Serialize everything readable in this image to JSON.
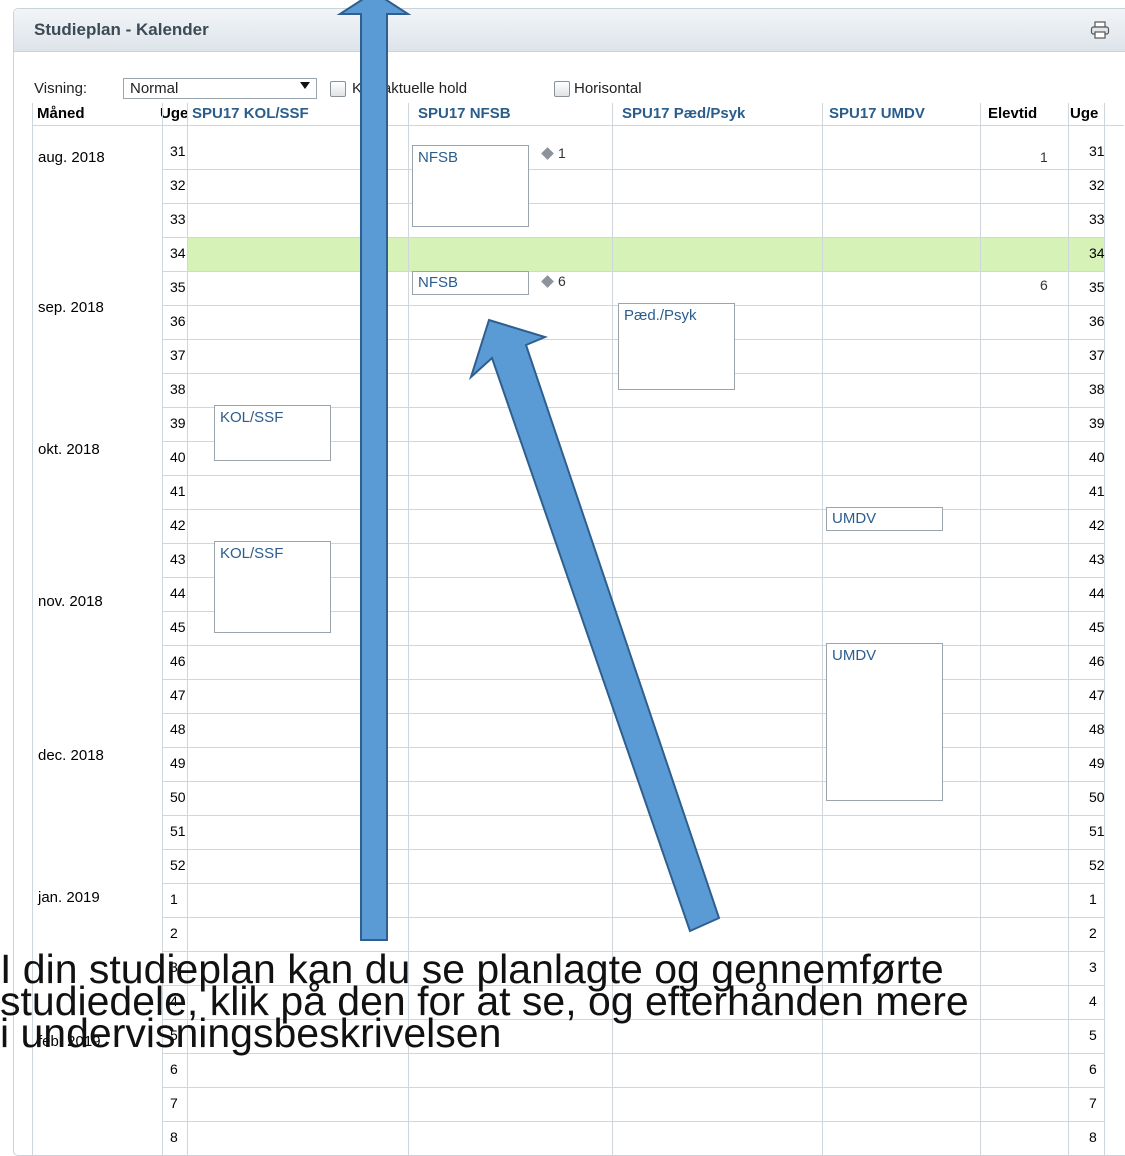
{
  "panel": {
    "title": "Studieplan - Kalender",
    "print_icon": "printer-icon"
  },
  "toolbar": {
    "visning_label": "Visning:",
    "visning_value": "Normal",
    "kun_aktuelle_label": "Kun aktuelle hold",
    "horisontal_label": "Horisontal"
  },
  "table": {
    "headers": {
      "month": "Måned",
      "week": "Uge",
      "col1": "SPU17 KOL/SSF",
      "col2": "SPU17 NFSB",
      "col3": "SPU17 Pæd/Psyk",
      "col4": "SPU17 UMDV",
      "elevtid": "Elevtid",
      "week_right": "Uge"
    },
    "months": [
      "aug. 2018",
      "sep. 2018",
      "okt. 2018",
      "nov. 2018",
      "dec. 2018",
      "jan. 2019",
      "feb. 2019"
    ],
    "weeks": [
      "31",
      "32",
      "33",
      "34",
      "35",
      "36",
      "37",
      "38",
      "39",
      "40",
      "41",
      "42",
      "43",
      "44",
      "45",
      "46",
      "47",
      "48",
      "49",
      "50",
      "51",
      "52",
      "1",
      "2",
      "3",
      "4",
      "5",
      "6",
      "7",
      "8"
    ],
    "events": {
      "nfsb_1": "NFSB",
      "nfsb_1_count": "1",
      "nfsb_2": "NFSB",
      "nfsb_2_count": "6",
      "paed": "Pæd./Psyk",
      "kol_1": "KOL/SSF",
      "kol_2": "KOL/SSF",
      "umdv_1": "UMDV",
      "umdv_2": "UMDV"
    },
    "elevtid": {
      "w31": "1",
      "w35": "6"
    },
    "highlight_week": "34",
    "highlight_color": "#d6f2b7"
  },
  "overlay": {
    "line1": "I din studieplan kan du se planlagte og gennemførte",
    "line2": "studiedele, klik på den for at se, og efterhånden mere",
    "line3": "i undervisningsbeskrivelsen"
  },
  "colors": {
    "arrow": "#5b9bd5",
    "arrow_border": "#2e5f8e",
    "link": "#2a5d8c"
  }
}
